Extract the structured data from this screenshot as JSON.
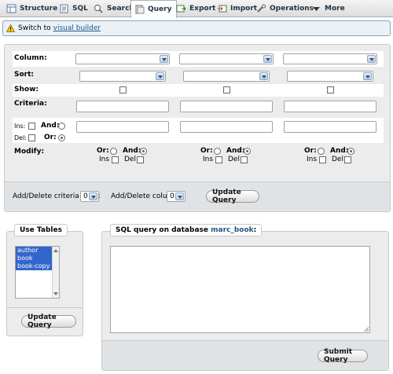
{
  "tabs": [
    {
      "label": "Structure",
      "icon": "structure-icon"
    },
    {
      "label": "SQL",
      "icon": "sql-icon"
    },
    {
      "label": "Search",
      "icon": "search-icon"
    },
    {
      "label": "Query",
      "icon": "query-icon"
    },
    {
      "label": "Export",
      "icon": "export-icon"
    },
    {
      "label": "Import",
      "icon": "import-icon"
    },
    {
      "label": "Operations",
      "icon": "operations-icon"
    },
    {
      "label": "More",
      "icon": "chevron-down-icon"
    }
  ],
  "notice": {
    "text": "Switch to",
    "link": "visual builder"
  },
  "criteria": {
    "row_labels": {
      "column": "Column:",
      "sort": "Sort:",
      "show": "Show:",
      "criteria": "Criteria:",
      "modify": "Modify:"
    },
    "ins": "Ins:",
    "del": "Del:",
    "and": "And:",
    "or": "Or:",
    "mod_or": "Or:",
    "mod_and": "And:",
    "mod_ins": "Ins",
    "mod_del": "Del",
    "footer": {
      "rows_label": "Add/Delete criteria rows:",
      "rows_value": "0",
      "cols_label": "Add/Delete columns:",
      "cols_value": "0",
      "update_button": "Update Query"
    }
  },
  "use_tables": {
    "legend": "Use Tables",
    "tables": [
      "author",
      "book",
      "book-copy"
    ],
    "update_button": "Update Query"
  },
  "sql_query": {
    "legend_prefix": "SQL query on database",
    "database": "marc_book",
    "legend_suffix": ":",
    "submit_button": "Submit Query"
  },
  "colors": {
    "accent": "#3366cc",
    "link": "#225588"
  }
}
